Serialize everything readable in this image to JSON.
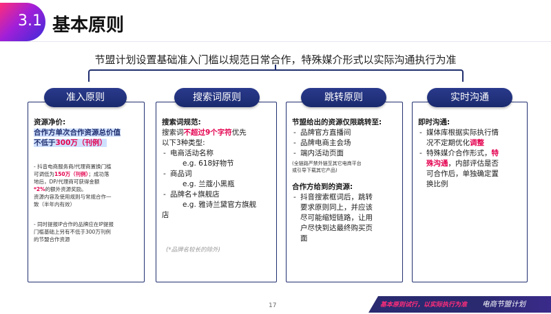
{
  "header": {
    "section_num": "3.1",
    "title": "基本原则"
  },
  "subtitle": "节盟计划设置基础准入门槛以规范日常合作，特殊媒介形式以实际沟通执行为准",
  "columns": {
    "c1": {
      "title": "准入原则",
      "l1": "资源净价:",
      "l2": "合作方单次合作资源总价值",
      "l3a": "不低于",
      "l3b": "300万（刊例）",
      "p1": "- 抖音电商服务商/代理商置换门槛",
      "p2a": "可调低为",
      "p2b": "150万（刊例）",
      "p2c": "；成功落",
      "p3": "地后，DP/代理商可获得金额",
      "p4a": "*2%",
      "p4b": "的额外资源奖励。",
      "p5": "资源内容及使用规则与常规合作一",
      "p6": "致（半年内有效）",
      "q1": "- 同时提报IP合作的品牌应在IP提报",
      "q2": "门槛基础上另有不低于300万刊例",
      "q3": "的节盟合作资源"
    },
    "c2": {
      "title": "搜索词原则",
      "l1": "搜索词规范:",
      "l2a": "搜索词",
      "l2b": "不超过9个字符",
      "l2c": "优先",
      "l3": "以下3种类型:",
      "i1": "电商活动名称",
      "e1": "e.g. 618好物节",
      "i2": "商品词",
      "e2": "e.g. 兰蔻小黑瓶",
      "i3": "品牌名+旗舰店",
      "e3": "e.g. 雅诗兰黛官方旗舰",
      "e3b": "店",
      "note": "(*品牌名较长的除外)"
    },
    "c3": {
      "title": "跳转原则",
      "l1": "节盟给出的资源仅限跳转至:",
      "i1": "品牌官方直播间",
      "i2": "品牌电商主会场",
      "i3": "端内活动页面",
      "n1": "(全链路严禁外链至其它电商平台",
      "n2": "或引导下载其它产品)",
      "l2": "合作方给到的资源:",
      "j1": "抖音搜索框词后，跳转",
      "j2": "要求原则同上，并应该",
      "j3": "尽可能缩短链路，让用",
      "j4": "户尽快到达最终购买页",
      "j5": "面"
    },
    "c4": {
      "title": "实时沟通",
      "l1": "即时沟通:",
      "i1a": "媒体库根据实际执行情",
      "i1b": "况不定期优化",
      "i1c": "调整",
      "i2a": "特殊媒介合作形式，",
      "i2b": "特",
      "i2c": "殊沟通",
      "i2d": "，内部评估是否",
      "i2e": "可合作后，单独确定置",
      "i2f": "换比例"
    }
  },
  "footer": {
    "page": "17",
    "slogan": "基本原则试行，以实际执行为准",
    "brand": "电商节盟计划"
  },
  "colors": {
    "navy": "#1f2e6e",
    "pink": "#e4004f",
    "highlight": "#cfe0ff"
  }
}
